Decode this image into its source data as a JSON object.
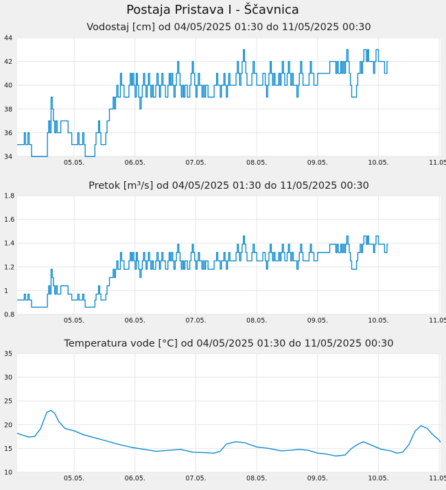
{
  "station_title": "Postaja Pristava I - Ščavnica",
  "chart_data": [
    {
      "type": "line",
      "title": "Vodostaj [cm] od 04/05/2025 01:30 do 11/05/2025 00:30",
      "x_unit": "day",
      "xlim": [
        4.063,
        11.02
      ],
      "ylim": [
        34,
        44
      ],
      "yticks": [
        "34",
        "36",
        "38",
        "40",
        "42",
        "44"
      ],
      "xticks": [
        {
          "x": 5.0,
          "label": "05.05."
        },
        {
          "x": 6.0,
          "label": "06.05."
        },
        {
          "x": 7.0,
          "label": "07.05."
        },
        {
          "x": 8.0,
          "label": "08.05."
        },
        {
          "x": 9.0,
          "label": "09.05."
        },
        {
          "x": 10.0,
          "label": "10.05."
        },
        {
          "x": 11.0,
          "label": "11.05."
        }
      ],
      "grid": true,
      "color": "#0a8ad0",
      "step": 1,
      "x": [
        4.063,
        4.14,
        4.16,
        4.18,
        4.2,
        4.22,
        4.24,
        4.26,
        4.3,
        4.32,
        4.52,
        4.56,
        4.58,
        4.6,
        4.62,
        4.64,
        4.66,
        4.68,
        4.7,
        4.72,
        4.74,
        4.76,
        4.78,
        4.9,
        4.92,
        4.96,
        5.0,
        5.02,
        5.04,
        5.06,
        5.08,
        5.1,
        5.14,
        5.16,
        5.18,
        5.3,
        5.34,
        5.36,
        5.4,
        5.42,
        5.44,
        5.46,
        5.48,
        5.5,
        5.52,
        5.54,
        5.56,
        5.58,
        5.62,
        5.64,
        5.66,
        5.68,
        5.7,
        5.72,
        5.76,
        5.78,
        5.82,
        5.9,
        5.92,
        5.94,
        5.96,
        5.98,
        6.0,
        6.02,
        6.04,
        6.06,
        6.08,
        6.1,
        6.12,
        6.14,
        6.16,
        6.18,
        6.2,
        6.22,
        6.24,
        6.26,
        6.28,
        6.3,
        6.32,
        6.34,
        6.36,
        6.38,
        6.4,
        6.42,
        6.44,
        6.46,
        6.48,
        6.5,
        6.52,
        6.54,
        6.56,
        6.58,
        6.6,
        6.62,
        6.64,
        6.66,
        6.68,
        6.7,
        6.72,
        6.74,
        6.76,
        6.78,
        6.8,
        6.82,
        6.84,
        6.86,
        6.88,
        6.9,
        6.92,
        6.94,
        6.96,
        6.98,
        7.0,
        7.02,
        7.04,
        7.06,
        7.08,
        7.1,
        7.12,
        7.14,
        7.16,
        7.18,
        7.2,
        7.24,
        7.3,
        7.34,
        7.36,
        7.38,
        7.4,
        7.42,
        7.44,
        7.46,
        7.48,
        7.5,
        7.52,
        7.54,
        7.56,
        7.6,
        7.64,
        7.66,
        7.68,
        7.7,
        7.72,
        7.74,
        7.76,
        7.78,
        7.8,
        7.82,
        7.84,
        7.88,
        7.9,
        7.92,
        7.94,
        7.96,
        8.0,
        8.1,
        8.14,
        8.16,
        8.18,
        8.2,
        8.22,
        8.24,
        8.26,
        8.28,
        8.3,
        8.34,
        8.36,
        8.38,
        8.4,
        8.42,
        8.44,
        8.46,
        8.48,
        8.5,
        8.52,
        8.54,
        8.56,
        8.58,
        8.6,
        8.62,
        8.66,
        8.68,
        8.7,
        8.72,
        8.74,
        8.76,
        8.78,
        8.8,
        8.82,
        8.84,
        8.86,
        8.88,
        8.9,
        8.94,
        9.0,
        9.2,
        9.3,
        9.32,
        9.34,
        9.36,
        9.38,
        9.4,
        9.42,
        9.44,
        9.46,
        9.48,
        9.5,
        9.52,
        9.54,
        9.56,
        9.58,
        9.6,
        9.62,
        9.64,
        9.66,
        9.7,
        9.72,
        9.74,
        9.76,
        9.8,
        9.82,
        9.84,
        9.86,
        9.88,
        9.9,
        9.92,
        9.94,
        9.96,
        10.0,
        10.1,
        10.14,
        10.16,
        10.18,
        10.2,
        10.22,
        10.24,
        10.26,
        10.3,
        10.6,
        10.62,
        10.64,
        10.66,
        10.68,
        10.7,
        10.72,
        10.74,
        10.76,
        10.78,
        10.9,
        10.92,
        10.94,
        10.96,
        10.98,
        11.0,
        11.02
      ],
      "values": [
        35,
        35,
        35,
        36,
        35,
        35,
        36,
        35,
        34,
        34,
        34,
        36,
        37,
        36,
        39,
        38,
        37,
        36,
        37,
        36,
        36,
        36,
        37,
        36,
        36,
        35,
        35,
        35,
        35,
        36,
        35,
        35,
        36,
        35,
        34,
        34,
        35,
        36,
        37,
        36,
        35,
        35,
        35,
        35,
        36,
        37,
        37,
        38,
        38,
        39,
        38,
        39,
        40,
        39,
        41,
        40,
        39,
        40,
        41,
        40,
        41,
        40,
        39,
        41,
        40,
        39,
        38,
        39,
        40,
        41,
        40,
        39,
        40,
        41,
        40,
        39,
        40,
        39,
        39,
        40,
        41,
        40,
        39,
        40,
        41,
        40,
        40,
        39,
        39,
        40,
        41,
        40,
        41,
        40,
        39,
        40,
        41,
        42,
        41,
        40,
        39,
        40,
        39,
        40,
        40,
        39,
        39,
        40,
        41,
        42,
        41,
        40,
        39,
        40,
        41,
        40,
        40,
        39,
        40,
        39,
        40,
        40,
        39,
        39,
        40,
        41,
        40,
        40,
        39,
        40,
        40,
        41,
        40,
        39,
        40,
        41,
        40,
        40,
        40,
        41,
        42,
        41,
        40,
        41,
        42,
        43,
        42,
        41,
        40,
        40,
        40,
        41,
        42,
        41,
        40,
        41,
        40,
        39,
        40,
        41,
        42,
        41,
        40,
        41,
        40,
        40,
        41,
        40,
        41,
        42,
        41,
        40,
        40,
        41,
        42,
        41,
        40,
        41,
        40,
        40,
        39,
        40,
        41,
        42,
        41,
        40,
        40,
        40,
        40,
        40,
        41,
        42,
        41,
        40,
        41,
        42,
        41,
        42,
        41,
        41,
        42,
        41,
        42,
        41,
        42,
        43,
        42,
        41,
        40,
        39,
        39,
        39,
        39,
        40,
        41,
        42,
        41,
        42,
        43,
        42,
        43,
        42,
        42,
        42,
        42,
        41,
        42,
        43,
        42,
        41,
        42
      ]
    },
    {
      "type": "line",
      "title": "Pretok [m³/s] od 04/05/2025 01:30 do 11/05/2025 00:30",
      "x_unit": "day",
      "xlim": [
        4.063,
        11.02
      ],
      "ylim": [
        0.8,
        1.8
      ],
      "yticks": [
        "0.8",
        "1",
        "1.2",
        "1.4",
        "1.6",
        "1.8"
      ],
      "xticks": [
        {
          "x": 5.0,
          "label": "05.05."
        },
        {
          "x": 6.0,
          "label": "06.05."
        },
        {
          "x": 7.0,
          "label": "07.05."
        },
        {
          "x": 8.0,
          "label": "08.05."
        },
        {
          "x": 9.0,
          "label": "09.05."
        },
        {
          "x": 10.0,
          "label": "10.05."
        },
        {
          "x": 11.0,
          "label": "11.05."
        }
      ],
      "grid": true,
      "color": "#0a8ad0",
      "step": 1,
      "x": [
        4.063,
        4.14,
        4.16,
        4.18,
        4.2,
        4.22,
        4.24,
        4.26,
        4.3,
        4.32,
        4.52,
        4.56,
        4.58,
        4.6,
        4.62,
        4.64,
        4.66,
        4.68,
        4.7,
        4.72,
        4.74,
        4.76,
        4.78,
        4.9,
        4.92,
        4.96,
        5.0,
        5.02,
        5.04,
        5.06,
        5.08,
        5.1,
        5.14,
        5.16,
        5.18,
        5.3,
        5.34,
        5.36,
        5.4,
        5.42,
        5.44,
        5.46,
        5.48,
        5.5,
        5.52,
        5.54,
        5.56,
        5.58,
        5.62,
        5.64,
        5.66,
        5.68,
        5.7,
        5.72,
        5.76,
        5.78,
        5.82,
        5.9,
        5.92,
        5.94,
        5.96,
        5.98,
        6.0,
        6.02,
        6.04,
        6.06,
        6.08,
        6.1,
        6.12,
        6.14,
        6.16,
        6.18,
        6.2,
        6.22,
        6.24,
        6.26,
        6.28,
        6.3,
        6.32,
        6.34,
        6.36,
        6.38,
        6.4,
        6.42,
        6.44,
        6.46,
        6.48,
        6.5,
        6.52,
        6.54,
        6.56,
        6.58,
        6.6,
        6.62,
        6.64,
        6.66,
        6.68,
        6.7,
        6.72,
        6.74,
        6.76,
        6.78,
        6.8,
        6.82,
        6.84,
        6.86,
        6.88,
        6.9,
        6.92,
        6.94,
        6.96,
        6.98,
        7.0,
        7.02,
        7.04,
        7.06,
        7.08,
        7.1,
        7.12,
        7.14,
        7.16,
        7.18,
        7.2,
        7.24,
        7.3,
        7.34,
        7.36,
        7.38,
        7.4,
        7.42,
        7.44,
        7.46,
        7.48,
        7.5,
        7.52,
        7.54,
        7.56,
        7.6,
        7.64,
        7.66,
        7.68,
        7.7,
        7.72,
        7.74,
        7.76,
        7.78,
        7.8,
        7.82,
        7.84,
        7.88,
        7.9,
        7.92,
        7.94,
        7.96,
        8.0,
        8.1,
        8.14,
        8.16,
        8.18,
        8.2,
        8.22,
        8.24,
        8.26,
        8.28,
        8.3,
        8.34,
        8.36,
        8.38,
        8.4,
        8.42,
        8.44,
        8.46,
        8.48,
        8.5,
        8.52,
        8.54,
        8.56,
        8.58,
        8.6,
        8.62,
        8.66,
        8.68,
        8.7,
        8.72,
        8.74,
        8.76,
        8.78,
        8.8,
        8.82,
        8.84,
        8.86,
        8.88,
        8.9,
        8.94,
        9.0,
        9.2,
        9.3,
        9.32,
        9.34,
        9.36,
        9.38,
        9.4,
        9.42,
        9.44,
        9.46,
        9.48,
        9.5,
        9.52,
        9.54,
        9.56,
        9.58,
        9.6,
        9.62,
        9.64,
        9.66,
        9.7,
        9.72,
        9.74,
        9.76,
        9.8,
        9.82,
        9.84,
        9.86,
        9.88,
        9.9,
        9.92,
        9.94,
        9.96,
        10.0,
        10.1,
        10.14,
        10.16,
        10.18,
        10.2,
        10.22,
        10.24,
        10.26,
        10.3,
        10.6,
        10.62,
        10.64,
        10.66,
        10.68,
        10.7,
        10.72,
        10.74,
        10.76,
        10.78,
        10.9,
        10.92,
        10.94,
        10.96,
        10.98,
        11.0,
        11.02
      ],
      "values": [
        0.92,
        0.92,
        0.92,
        0.97,
        0.92,
        0.92,
        0.97,
        0.92,
        0.86,
        0.86,
        0.86,
        0.97,
        1.04,
        0.97,
        1.18,
        1.11,
        1.04,
        0.97,
        1.04,
        0.97,
        0.97,
        0.97,
        1.04,
        0.97,
        0.97,
        0.92,
        0.92,
        0.92,
        0.92,
        0.97,
        0.92,
        0.92,
        0.97,
        0.92,
        0.86,
        0.86,
        0.92,
        0.97,
        1.04,
        0.97,
        0.92,
        0.92,
        0.92,
        0.92,
        0.97,
        1.04,
        1.04,
        1.11,
        1.11,
        1.18,
        1.11,
        1.18,
        1.25,
        1.18,
        1.32,
        1.25,
        1.18,
        1.25,
        1.32,
        1.25,
        1.32,
        1.25,
        1.18,
        1.32,
        1.25,
        1.18,
        1.11,
        1.18,
        1.25,
        1.32,
        1.25,
        1.18,
        1.25,
        1.32,
        1.25,
        1.18,
        1.25,
        1.18,
        1.18,
        1.25,
        1.32,
        1.25,
        1.18,
        1.25,
        1.32,
        1.25,
        1.25,
        1.18,
        1.18,
        1.25,
        1.32,
        1.25,
        1.32,
        1.25,
        1.18,
        1.25,
        1.32,
        1.39,
        1.32,
        1.25,
        1.18,
        1.25,
        1.18,
        1.25,
        1.25,
        1.18,
        1.18,
        1.25,
        1.32,
        1.39,
        1.32,
        1.25,
        1.18,
        1.25,
        1.32,
        1.25,
        1.25,
        1.18,
        1.25,
        1.18,
        1.25,
        1.25,
        1.18,
        1.18,
        1.25,
        1.32,
        1.25,
        1.25,
        1.18,
        1.25,
        1.25,
        1.32,
        1.25,
        1.18,
        1.25,
        1.32,
        1.25,
        1.25,
        1.25,
        1.32,
        1.39,
        1.32,
        1.25,
        1.32,
        1.39,
        1.46,
        1.39,
        1.32,
        1.25,
        1.25,
        1.25,
        1.32,
        1.39,
        1.32,
        1.25,
        1.32,
        1.25,
        1.18,
        1.25,
        1.32,
        1.39,
        1.32,
        1.25,
        1.32,
        1.25,
        1.25,
        1.32,
        1.25,
        1.32,
        1.39,
        1.32,
        1.25,
        1.25,
        1.32,
        1.39,
        1.32,
        1.25,
        1.32,
        1.25,
        1.25,
        1.18,
        1.25,
        1.32,
        1.39,
        1.32,
        1.25,
        1.25,
        1.25,
        1.25,
        1.25,
        1.32,
        1.39,
        1.32,
        1.25,
        1.32,
        1.39,
        1.32,
        1.39,
        1.32,
        1.32,
        1.39,
        1.32,
        1.39,
        1.32,
        1.39,
        1.46,
        1.39,
        1.32,
        1.25,
        1.18,
        1.18,
        1.18,
        1.18,
        1.25,
        1.32,
        1.39,
        1.32,
        1.39,
        1.46,
        1.39,
        1.46,
        1.39,
        1.39,
        1.39,
        1.39,
        1.32,
        1.39,
        1.46,
        1.39,
        1.32,
        1.39
      ]
    },
    {
      "type": "line",
      "title": "Temperatura vode [°C] od 04/05/2025 01:30 do 11/05/2025 00:30",
      "x_unit": "day",
      "xlim": [
        4.063,
        11.02
      ],
      "ylim": [
        10,
        35
      ],
      "yticks": [
        "10",
        "15",
        "20",
        "25",
        "30",
        "35"
      ],
      "xticks": [
        {
          "x": 5.0,
          "label": "05.05."
        },
        {
          "x": 6.0,
          "label": "06.05."
        },
        {
          "x": 7.0,
          "label": "07.05."
        },
        {
          "x": 8.0,
          "label": "08.05."
        },
        {
          "x": 9.0,
          "label": "09.05."
        },
        {
          "x": 10.0,
          "label": "10.05."
        },
        {
          "x": 11.0,
          "label": "11.05."
        }
      ],
      "grid": true,
      "color": "#0a8ad0",
      "step": 0,
      "x": [
        4.063,
        4.15,
        4.25,
        4.35,
        4.45,
        4.55,
        4.62,
        4.68,
        4.75,
        4.85,
        5.0,
        5.15,
        5.35,
        5.55,
        5.75,
        5.95,
        6.15,
        6.35,
        6.55,
        6.75,
        6.95,
        7.15,
        7.3,
        7.4,
        7.5,
        7.65,
        7.8,
        8.0,
        8.2,
        8.4,
        8.55,
        8.7,
        8.85,
        9.0,
        9.15,
        9.3,
        9.45,
        9.55,
        9.65,
        9.75,
        9.9,
        10.05,
        10.2,
        10.3,
        10.4,
        10.5,
        10.6,
        10.7,
        10.8,
        10.9,
        11.0,
        11.02
      ],
      "values": [
        18.2,
        17.8,
        17.4,
        17.5,
        19.2,
        22.6,
        23.0,
        22.4,
        20.6,
        19.2,
        18.7,
        17.9,
        17.2,
        16.5,
        15.8,
        15.2,
        14.8,
        14.4,
        14.6,
        14.8,
        14.2,
        14.1,
        14.0,
        14.4,
        15.9,
        16.4,
        16.2,
        15.3,
        15.0,
        14.5,
        14.6,
        14.8,
        14.6,
        14.0,
        13.8,
        13.4,
        13.6,
        14.9,
        15.8,
        16.4,
        15.6,
        14.8,
        14.5,
        14.0,
        14.2,
        15.8,
        18.6,
        19.8,
        19.2,
        17.8,
        16.7,
        16.3
      ]
    }
  ]
}
